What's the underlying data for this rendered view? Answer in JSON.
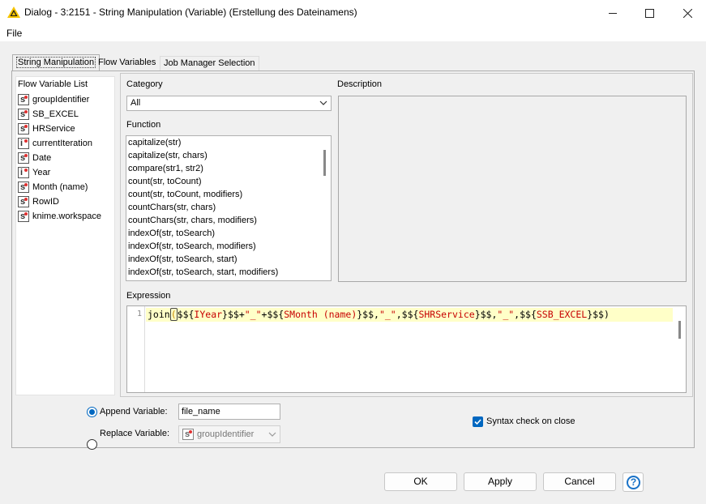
{
  "window": {
    "title": "Dialog - 3:2151 - String Manipulation (Variable) (Erstellung des Dateinamens)",
    "minimize_icon": "minimize-icon",
    "maximize_icon": "maximize-icon",
    "close_icon": "close-icon"
  },
  "menu": {
    "file": "File"
  },
  "tabs": [
    "String Manipulation",
    "Flow Variables",
    "Job Manager Selection"
  ],
  "flow_variables": {
    "header": "Flow Variable List",
    "items": [
      {
        "type": "s",
        "name": "groupIdentifier"
      },
      {
        "type": "s",
        "name": "SB_EXCEL"
      },
      {
        "type": "s",
        "name": "HRService"
      },
      {
        "type": "i",
        "name": "currentIteration"
      },
      {
        "type": "s",
        "name": "Date"
      },
      {
        "type": "i",
        "name": "Year"
      },
      {
        "type": "s",
        "name": "Month (name)"
      },
      {
        "type": "s",
        "name": "RowID"
      },
      {
        "type": "s",
        "name": "knime.workspace"
      }
    ]
  },
  "category": {
    "label": "Category",
    "selected": "All"
  },
  "function": {
    "label": "Function",
    "items": [
      "capitalize(str)",
      "capitalize(str, chars)",
      "compare(str1, str2)",
      "count(str, toCount)",
      "count(str, toCount, modifiers)",
      "countChars(str, chars)",
      "countChars(str, chars, modifiers)",
      "indexOf(str, toSearch)",
      "indexOf(str, toSearch, modifiers)",
      "indexOf(str, toSearch, start)",
      "indexOf(str, toSearch, start, modifiers)"
    ]
  },
  "description": {
    "label": "Description"
  },
  "expression": {
    "label": "Expression",
    "line_number": "1",
    "code": {
      "fn": "join",
      "open": "(",
      "p1": "$${",
      "v1": "IYear",
      "p2": "}$$+",
      "s1": "\"_\"",
      "p3": "+$${",
      "v2": "SMonth (name)",
      "p4": "}$$,",
      "s2": "\"_\"",
      "p5": ",$${",
      "v3": "SHRService",
      "p6": "}$$,",
      "s3": "\"_\"",
      "p7": ",$${",
      "v4": "SSB_EXCEL",
      "p8": "}$$)"
    }
  },
  "output": {
    "append_label": "Append Variable:",
    "append_value": "file_name",
    "append_selected": true,
    "replace_label": "Replace Variable:",
    "replace_value": "groupIdentifier",
    "replace_type": "s"
  },
  "syntax_check": {
    "label": "Syntax check on close",
    "checked": true
  },
  "buttons": {
    "ok": "OK",
    "apply": "Apply",
    "cancel": "Cancel",
    "help": "?"
  }
}
